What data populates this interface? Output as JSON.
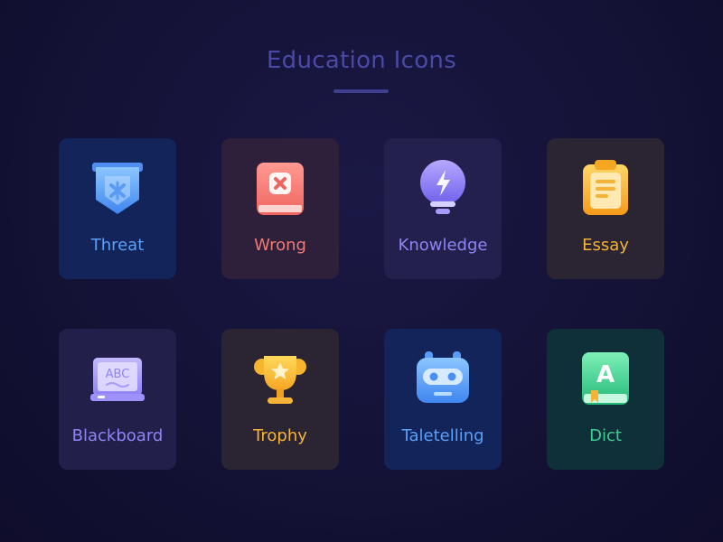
{
  "page": {
    "title": "Education Icons"
  },
  "cards": [
    {
      "label": "Threat",
      "icon": "shield-badge-icon",
      "color": "#5aa0f8",
      "bg": "#12245a"
    },
    {
      "label": "Wrong",
      "icon": "book-x-icon",
      "color": "#f07a76",
      "bg": "#2e1f3b"
    },
    {
      "label": "Knowledge",
      "icon": "lightbulb-bolt-icon",
      "color": "#8c85f2",
      "bg": "#24204e"
    },
    {
      "label": "Essay",
      "icon": "clipboard-icon",
      "color": "#f5b437",
      "bg": "#2b2432"
    },
    {
      "label": "Blackboard",
      "icon": "abc-board-icon",
      "color": "#8e86f5",
      "bg": "#221f4a"
    },
    {
      "label": "Trophy",
      "icon": "trophy-star-icon",
      "color": "#f5b437",
      "bg": "#2b2432"
    },
    {
      "label": "Taletelling",
      "icon": "robot-icon",
      "color": "#5aa0f8",
      "bg": "#12245a"
    },
    {
      "label": "Dict",
      "icon": "dictionary-book-icon",
      "color": "#3ecf93",
      "bg": "#0f3038"
    }
  ],
  "icon_text": {
    "board": "ABC",
    "dict": "A"
  }
}
